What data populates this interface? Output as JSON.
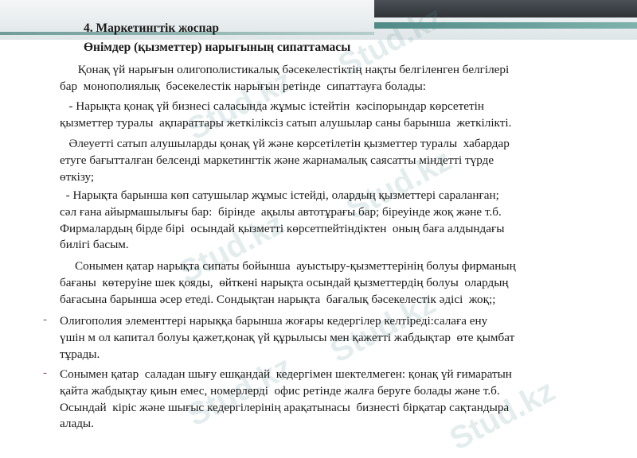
{
  "doc": {
    "heading_section": "4. Маркетингтік жоспар",
    "heading_sub": "Өнімдер (қызметтер) нарығының сипаттамасы",
    "paragraphs": [
      {
        "lines": [
          "      Қонақ үй нарығын олигополистикалық бәсекелестіктің нақты белгіленген белгілері",
          "бар  монополиялық  бәсекелестік нарығын ретінде  сипаттауға болады:"
        ]
      },
      {
        "lines": [
          "   - Нарықта қонақ үй бизнесі саласында жұмыс істейтін  кәсіпорындар көрсететін",
          "қызметтер туралы  ақпараттары жеткіліксіз сатып алушылар саны барынша  жеткілікті."
        ]
      },
      {
        "lines": [
          "   Әлеуетті сатып алушыларды қонақ үй және көрсетілетін қызметтер туралы  хабардар",
          "етуге бағытталған белсенді маркетингтік және жарнамалық саясатты міндетті түрде",
          "өткізу;"
        ]
      },
      {
        "lines": [
          "  - Нарықта барынша көп сатушылар жұмыс істейді, олардың қызметтері сараланған;",
          "сәл ғана айырмашылығы бар:  бірінде  ақылы автотұрағы бар; біреуінде жоқ және т.б.",
          "Фирмалардың бірде бірі  осындай қызметті көрсетпейтіндіктен  оның баға алдындағы",
          "билігі басым."
        ]
      },
      {
        "lines": [
          "     Сонымен қатар нарықта сипаты бойынша  ауыстыру-қызметтерінің болуы фирманың",
          "бағаны  көтеруіне шек қояды,  өйткені нарықта осындай қызметтердің болуы  олардың",
          "бағасына барынша әсер етеді. Сондықтан нарықта  бағалық бәсекелестік әдісі  жоқ;;"
        ]
      },
      {
        "bullet": "-",
        "lines": [
          "Олигополия элементтері нарыққа барынша жоғары кедергілер келтіреді:салаға ену",
          "үшін м ол капитал болуы қажет,қонақ үй құрылысы мен қажетті жабдықтар  өте қымбат",
          "тұрады."
        ]
      },
      {
        "bullet": "-",
        "lines": [
          "Сонымен қатар  саладан шығу ешқандай  кедергімен шектелмеген: қонақ үй ғимаратын",
          "қайта жабдықтау қиын емес, номерлерді  офис ретінде жалға беруге болады және т.б.",
          "Осындай  кіріс және шығыс кедергілерінің арақатынасы  бизнесті бірқатар сақтандыра",
          "алады."
        ]
      }
    ],
    "watermark_text": "Stud.kz",
    "colors": {
      "bullet": "#8c4a7a",
      "accent_teal": "#5f9793",
      "dark_bar": "#3a3e44"
    }
  }
}
